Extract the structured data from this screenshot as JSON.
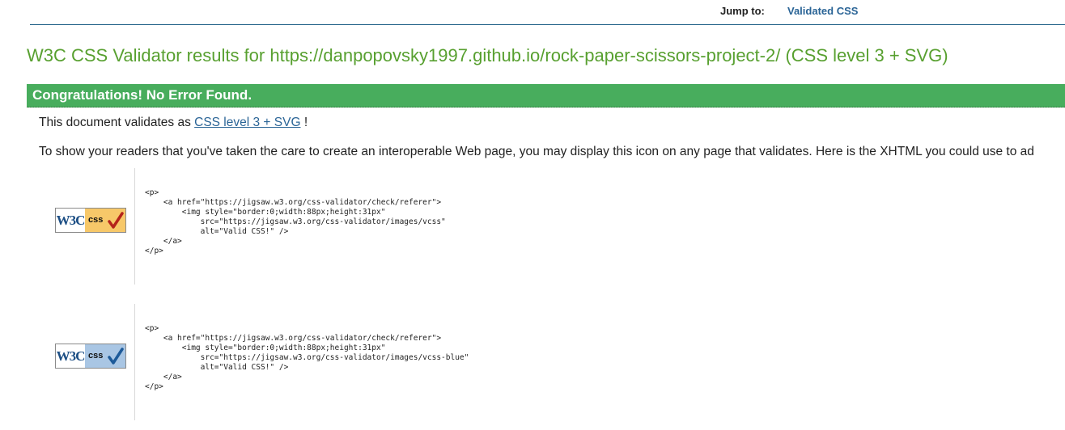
{
  "jump_bar": {
    "label": "Jump to:",
    "link": "Validated CSS"
  },
  "results": {
    "title": "W3C CSS Validator results for https://danpopovsky1997.github.io/rock-paper-scissors-project-2/ (CSS level 3 + SVG)"
  },
  "banner": {
    "text": "Congratulations! No Error Found.",
    "color": "#48ad5d"
  },
  "validation": {
    "prefix": "This document validates as ",
    "link": "CSS level 3 + SVG",
    "suffix": " !",
    "readers_text": "To show your readers that you've taken the care to create an interoperable Web page, you may display this icon on any page that validates. Here is the XHTML you could use to ad"
  },
  "badges": [
    {
      "w3c": "W3C",
      "css": "css",
      "variant": "gold",
      "code": "<p>\n    <a href=\"https://jigsaw.w3.org/css-validator/check/referer\">\n        <img style=\"border:0;width:88px;height:31px\"\n            src=\"https://jigsaw.w3.org/css-validator/images/vcss\"\n            alt=\"Valid CSS!\" />\n    </a>\n</p>"
    },
    {
      "w3c": "W3C",
      "css": "css",
      "variant": "blue",
      "code": "<p>\n    <a href=\"https://jigsaw.w3.org/css-validator/check/referer\">\n        <img style=\"border:0;width:88px;height:31px\"\n            src=\"https://jigsaw.w3.org/css-validator/images/vcss-blue\"\n            alt=\"Valid CSS!\" />\n    </a>\n</p>"
    }
  ]
}
